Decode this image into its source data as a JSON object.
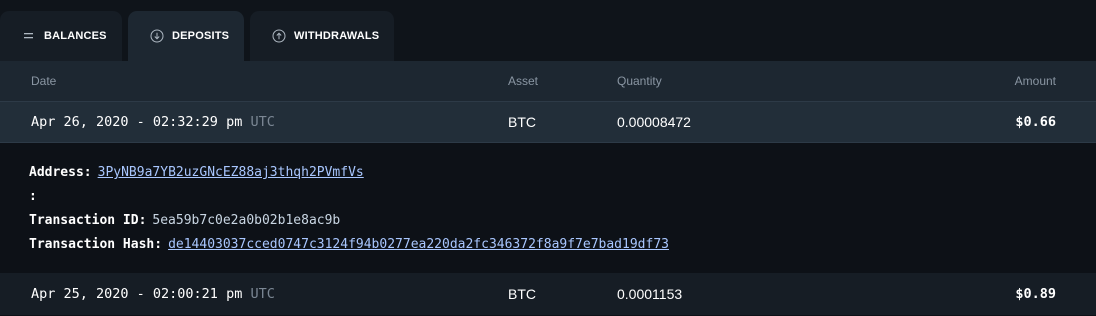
{
  "tabs": [
    {
      "label": "BALANCES",
      "icon": "list-icon"
    },
    {
      "label": "DEPOSITS",
      "icon": "arrow-down-circle-icon"
    },
    {
      "label": "WITHDRAWALS",
      "icon": "arrow-up-circle-icon"
    }
  ],
  "table": {
    "columns": [
      "Date",
      "Asset",
      "Quantity",
      "Amount"
    ],
    "rows": [
      {
        "date": "Apr 26, 2020 - 02:32:29 pm",
        "tz": "UTC",
        "asset": "BTC",
        "quantity": "0.00008472",
        "amount": "$0.66",
        "details": {
          "address_label": "Address:",
          "address": "3PyNB9a7YB2uzGNcEZ88aj3thqh2PVmfVs",
          "colon": ":",
          "txid_label": "Transaction ID:",
          "txid": "5ea59b7c0e2a0b02b1e8ac9b",
          "hash_label": "Transaction Hash:",
          "hash": "de14403037cced0747c3124f94b0277ea220da2fc346372f8a9f7e7bad19df73"
        }
      },
      {
        "date": "Apr 25, 2020 - 02:00:21 pm",
        "tz": "UTC",
        "asset": "BTC",
        "quantity": "0.0001153",
        "amount": "$0.89"
      }
    ]
  },
  "colors": {
    "background": "#0d1117",
    "header_bg": "#1d2731",
    "link": "#a9c7ff",
    "muted": "#7b8794"
  }
}
